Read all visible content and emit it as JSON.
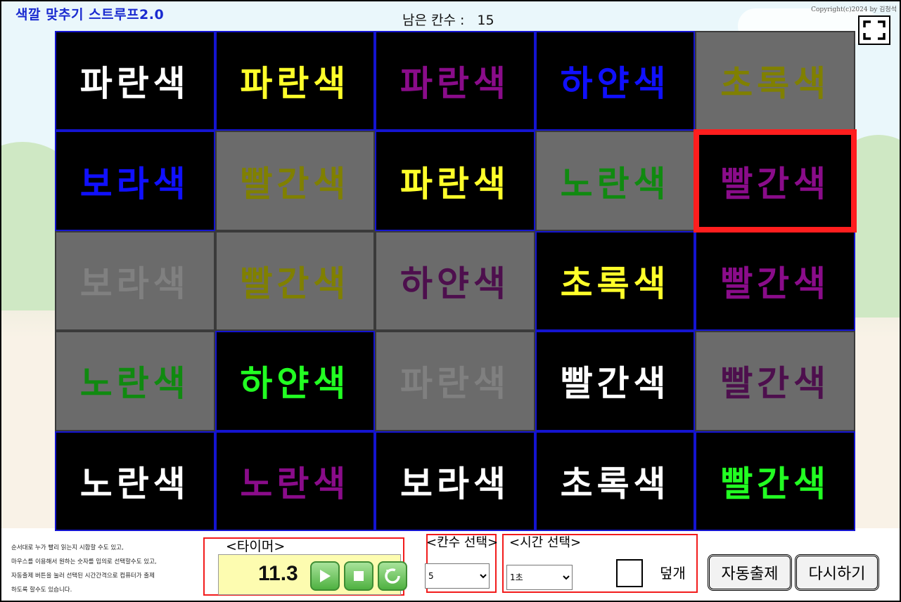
{
  "app": {
    "title": "색깔 맞추기 스트루프2.0",
    "remaining_label": "남은 칸수 :",
    "remaining_count": "15",
    "copyright": "Copyright(c)2024 by 김청석"
  },
  "board": {
    "cells": [
      {
        "text": "파란색",
        "color": "#ffffff",
        "bg": "black"
      },
      {
        "text": "파란색",
        "color": "#ffff2a",
        "bg": "black"
      },
      {
        "text": "파란색",
        "color": "#8a0c8a",
        "bg": "black"
      },
      {
        "text": "하얀색",
        "color": "#1010ff",
        "bg": "black"
      },
      {
        "text": "초록색",
        "color": "#808000",
        "bg": "gray"
      },
      {
        "text": "보라색",
        "color": "#1010ff",
        "bg": "black"
      },
      {
        "text": "빨간색",
        "color": "#808000",
        "bg": "gray"
      },
      {
        "text": "파란색",
        "color": "#ffff2a",
        "bg": "black"
      },
      {
        "text": "노란색",
        "color": "#108a10",
        "bg": "gray"
      },
      {
        "text": "빨간색",
        "color": "#8a0c8a",
        "bg": "black",
        "selected": true
      },
      {
        "text": "보라색",
        "color": "#808080",
        "bg": "gray"
      },
      {
        "text": "빨간색",
        "color": "#808000",
        "bg": "gray"
      },
      {
        "text": "하얀색",
        "color": "#4d0f4d",
        "bg": "gray"
      },
      {
        "text": "초록색",
        "color": "#ffff2a",
        "bg": "black"
      },
      {
        "text": "빨간색",
        "color": "#8a0c8a",
        "bg": "black"
      },
      {
        "text": "노란색",
        "color": "#108a10",
        "bg": "gray"
      },
      {
        "text": "하얀색",
        "color": "#22ff22",
        "bg": "black"
      },
      {
        "text": "파란색",
        "color": "#808080",
        "bg": "gray"
      },
      {
        "text": "빨간색",
        "color": "#ffffff",
        "bg": "black"
      },
      {
        "text": "빨간색",
        "color": "#4d0f4d",
        "bg": "gray"
      },
      {
        "text": "노란색",
        "color": "#ffffff",
        "bg": "black"
      },
      {
        "text": "노란색",
        "color": "#8a0c8a",
        "bg": "black"
      },
      {
        "text": "보라색",
        "color": "#ffffff",
        "bg": "black"
      },
      {
        "text": "초록색",
        "color": "#ffffff",
        "bg": "black"
      },
      {
        "text": "빨간색",
        "color": "#22ff22",
        "bg": "black"
      }
    ]
  },
  "instructions": [
    "순서대로 누가 빨리 읽는지 시합할 수도 있고,",
    "마우스를 이용해서 원하는 숫자를 임의로 선택할수도 있고,",
    "자동출제 버튼을 눌러 선택된 시간간격으로  컴퓨터가 출제",
    "하도록 할수도 있습니다."
  ],
  "timer": {
    "title": "<타이머>",
    "value": "11.3"
  },
  "count_select": {
    "title": "<칸수 선택>",
    "value": "5"
  },
  "time_select": {
    "title": "<시간 선택>",
    "value": "1초",
    "cover_label": "덮개"
  },
  "buttons": {
    "auto": "자동출제",
    "restart": "다시하기"
  }
}
